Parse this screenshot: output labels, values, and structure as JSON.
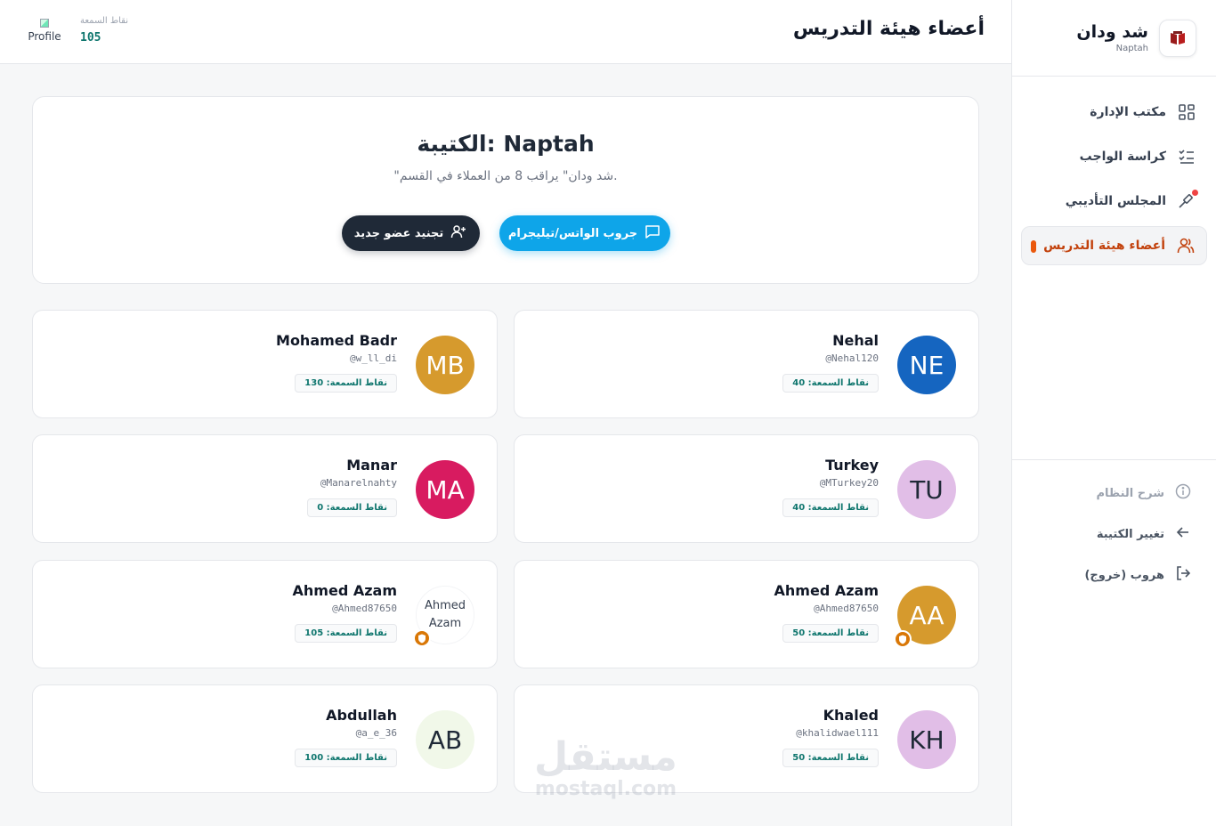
{
  "sidebar": {
    "brand_name": "شد ودان",
    "brand_sub": "Naptah",
    "items": [
      {
        "label": "مكتب الإدارة",
        "icon": "dashboard-grid-icon"
      },
      {
        "label": "كراسة الواجب",
        "icon": "checklist-icon"
      },
      {
        "label": "المجلس التأديبي",
        "icon": "gavel-icon"
      },
      {
        "label": "أعضاء هيئة التدريس",
        "icon": "users-icon"
      }
    ],
    "bottom": [
      {
        "label": "شرح النظام",
        "icon": "info-icon"
      },
      {
        "label": "تغيير الكتيبة",
        "icon": "arrow-left-icon"
      },
      {
        "label": "هروب (خروج)",
        "icon": "logout-icon"
      }
    ]
  },
  "header": {
    "title": "أعضاء هيئة التدريس",
    "profile_alt": "Profile",
    "reputation_label": "نقاط السمعة",
    "reputation_value": "105"
  },
  "hero": {
    "title": "الكتيبة: Naptah",
    "subtitle": "\"شد ودان\" يراقب 8 من العملاء في القسم.",
    "recruit_button": "تجنيد عضو جديد",
    "group_button": "جروب الواتس/تيليجرام"
  },
  "members": [
    {
      "name": "Nehal",
      "handle": "@Nehal120",
      "initials": "NE",
      "badge": "نقاط السمعة: 40",
      "color": "#1565c0",
      "shield": false
    },
    {
      "name": "Mohamed Badr",
      "handle": "@w_ll_di",
      "initials": "MB",
      "badge": "نقاط السمعة: 130",
      "color": "#d69a2d",
      "shield": false
    },
    {
      "name": "Turkey",
      "handle": "@MTurkey20",
      "initials": "TU",
      "badge": "نقاط السمعة: 40",
      "color": "#e1bee7",
      "shield": false
    },
    {
      "name": "Manar",
      "handle": "@Manarelnahty",
      "initials": "MA",
      "badge": "نقاط السمعة: 0",
      "color": "#d81b60",
      "shield": false
    },
    {
      "name": "Ahmed Azam",
      "handle": "@Ahmed87650",
      "initials": "AA",
      "badge": "نقاط السمعة: 50",
      "color": "#d69a2d",
      "shield": true
    },
    {
      "name": "Ahmed Azam",
      "handle": "@Ahmed87650",
      "initials": "Ahmed Azam",
      "badge": "نقاط السمعة: 105",
      "color": "#ffffff",
      "shield": true
    },
    {
      "name": "Khaled",
      "handle": "@khalidwael111",
      "initials": "KH",
      "badge": "نقاط السمعة: 50",
      "color": "#e1bee7",
      "shield": false
    },
    {
      "name": "Abdullah",
      "handle": "@a_e_36",
      "initials": "AB",
      "badge": "نقاط السمعة: 100",
      "color": "#f1f8e9",
      "shield": false
    }
  ],
  "watermark": {
    "arabic": "مستقل",
    "latin": "mostaql.com"
  }
}
